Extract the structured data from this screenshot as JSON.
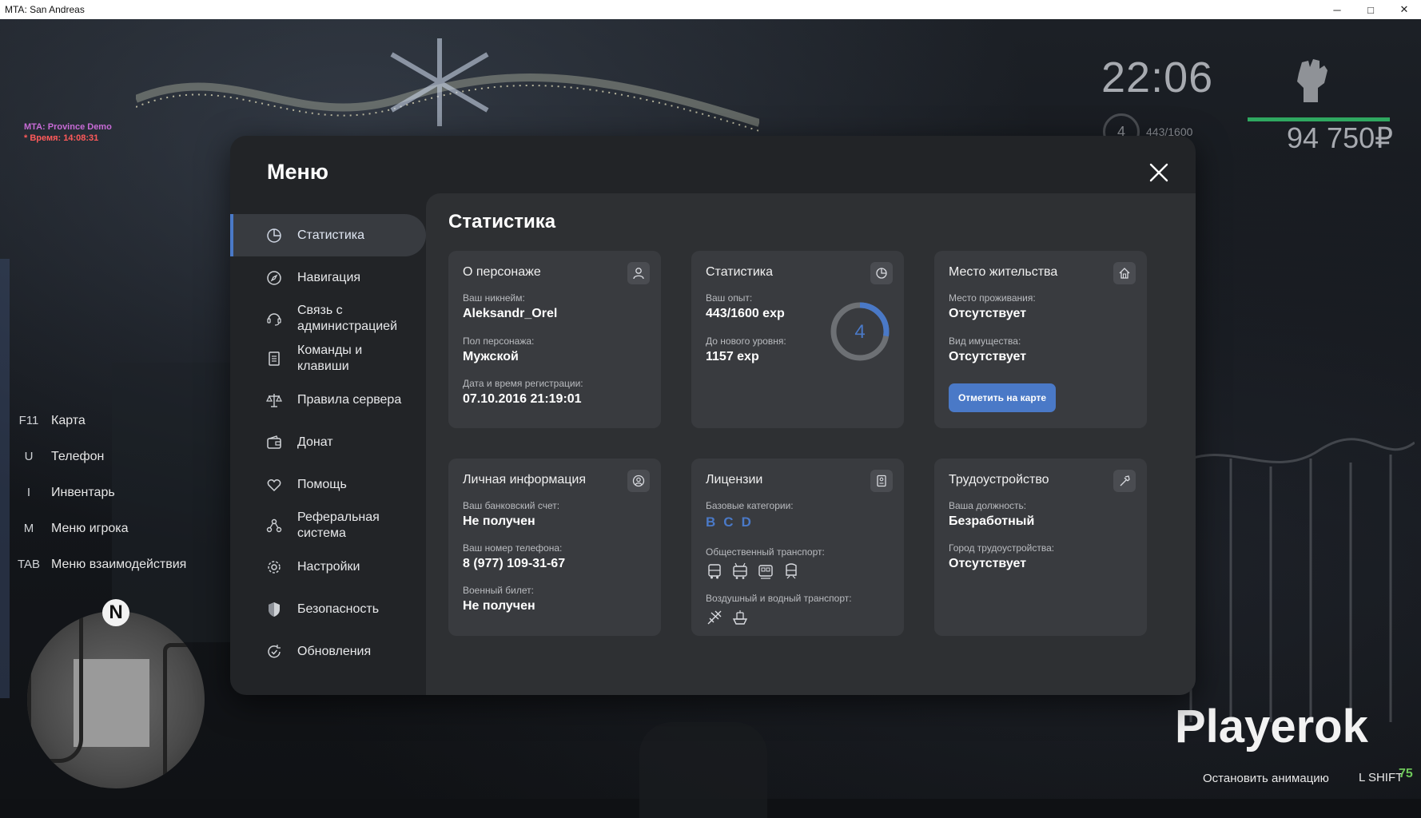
{
  "window": {
    "title": "MTA: San Andreas",
    "minimize": "─",
    "maximize": "□",
    "close": "✕"
  },
  "hud": {
    "demo_title": "MTA: Province Demo",
    "demo_time": "* Время: 14:08:31",
    "clock": "22:06",
    "level": "4",
    "exp": "443/1600",
    "money": "94 750₽",
    "hunger_fraction": 1.0
  },
  "keybinds": [
    {
      "key": "F11",
      "label": "Карта"
    },
    {
      "key": "U",
      "label": "Телефон"
    },
    {
      "key": "I",
      "label": "Инвентарь"
    },
    {
      "key": "M",
      "label": "Меню игрока"
    },
    {
      "key": "TAB",
      "label": "Меню взаимодействия"
    }
  ],
  "radar": {
    "north": "N"
  },
  "watermark": "Playerok",
  "bottom": {
    "stop_animation": "Остановить анимацию",
    "key": "L SHIFT",
    "fps": "75"
  },
  "menu": {
    "title": "Меню",
    "nav": [
      {
        "label": "Статистика",
        "icon": "pie-chart-icon"
      },
      {
        "label": "Навигация",
        "icon": "compass-icon"
      },
      {
        "label": "Связь с администрацией",
        "icon": "headset-icon"
      },
      {
        "label": "Команды и клавиши",
        "icon": "document-icon"
      },
      {
        "label": "Правила сервера",
        "icon": "scales-icon"
      },
      {
        "label": "Донат",
        "icon": "wallet-icon"
      },
      {
        "label": "Помощь",
        "icon": "heart-hand-icon"
      },
      {
        "label": "Реферальная система",
        "icon": "referral-icon"
      },
      {
        "label": "Настройки",
        "icon": "gear-icon"
      },
      {
        "label": "Безопасность",
        "icon": "shield-icon"
      },
      {
        "label": "Обновления",
        "icon": "refresh-check-icon"
      }
    ],
    "section_title": "Статистика",
    "cards": {
      "character": {
        "title": "О персонаже",
        "nick_label": "Ваш никнейм:",
        "nick": "Aleksandr_Orel",
        "gender_label": "Пол персонажа:",
        "gender": "Мужской",
        "reg_label": "Дата и время регистрации:",
        "reg": "07.10.2016 21:19:01"
      },
      "stats": {
        "title": "Статистика",
        "exp_label": "Ваш опыт:",
        "exp": "443/1600 exp",
        "next_label": "До нового уровня:",
        "next": "1157 exp",
        "level": "4",
        "progress": 0.277
      },
      "residence": {
        "title": "Место жительства",
        "place_label": "Место проживания:",
        "place": "Отсутствует",
        "property_label": "Вид имущества:",
        "property": "Отсутствует",
        "button": "Отметить на карте"
      },
      "personal": {
        "title": "Личная информация",
        "bank_label": "Ваш банковский счет:",
        "bank": "Не получен",
        "phone_label": "Ваш номер телефона:",
        "phone": "8 (977) 109-31-67",
        "military_label": "Военный билет:",
        "military": "Не получен"
      },
      "licenses": {
        "title": "Лицензии",
        "base_label": "Базовые категории:",
        "categories": [
          "B",
          "C",
          "D"
        ],
        "public_label": "Общественный транспорт:",
        "air_label": "Воздушный и водный транспорт:"
      },
      "employment": {
        "title": "Трудоустройство",
        "position_label": "Ваша должность:",
        "position": "Безработный",
        "city_label": "Город трудоустройства:",
        "city": "Отсутствует"
      }
    }
  },
  "colors": {
    "accent": "#4a79c7",
    "panel": "#222427",
    "content": "#2e3033",
    "card": "#393b3f",
    "hud_green": "#2fa860"
  }
}
